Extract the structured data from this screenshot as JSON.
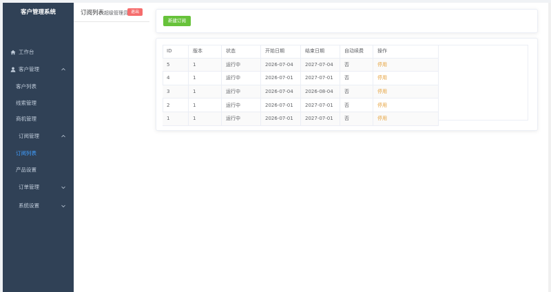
{
  "app": {
    "title": "客户管理系统"
  },
  "sidebar": {
    "items": [
      {
        "label": "工作台",
        "icon": "home-icon"
      },
      {
        "label": "客户管理",
        "icon": "user-icon"
      },
      {
        "label": "客户列表"
      },
      {
        "label": "线索管理"
      },
      {
        "label": "商机管理"
      },
      {
        "label": "订阅管理"
      },
      {
        "label": "订阅列表"
      },
      {
        "label": "产品设置"
      },
      {
        "label": "订单管理"
      },
      {
        "label": "系统设置"
      }
    ]
  },
  "header": {
    "title": "订阅列表",
    "role": "超级管理员",
    "logout_label": "退出"
  },
  "toolbar": {
    "new_label": "新建订阅"
  },
  "table": {
    "columns": [
      "ID",
      "版本",
      "状态",
      "开始日期",
      "结束日期",
      "自动续费",
      "操作"
    ],
    "rows": [
      [
        "5",
        "1",
        "运行中",
        "2026-07-04",
        "2027-07-04",
        "否",
        "停用"
      ],
      [
        "4",
        "1",
        "运行中",
        "2026-07-01",
        "2027-07-01",
        "否",
        "停用"
      ],
      [
        "3",
        "1",
        "运行中",
        "2026-07-04",
        "2026-08-04",
        "否",
        "停用"
      ],
      [
        "2",
        "1",
        "运行中",
        "2026-07-01",
        "2027-07-01",
        "否",
        "停用"
      ],
      [
        "1",
        "1",
        "运行中",
        "2026-07-01",
        "2027-07-01",
        "否",
        "停用"
      ]
    ]
  },
  "colors": {
    "sidebar_bg": "#304156",
    "active": "#409eff",
    "primary_green": "#67c23a",
    "danger": "#f56c6c",
    "warning": "#e6a23c"
  }
}
